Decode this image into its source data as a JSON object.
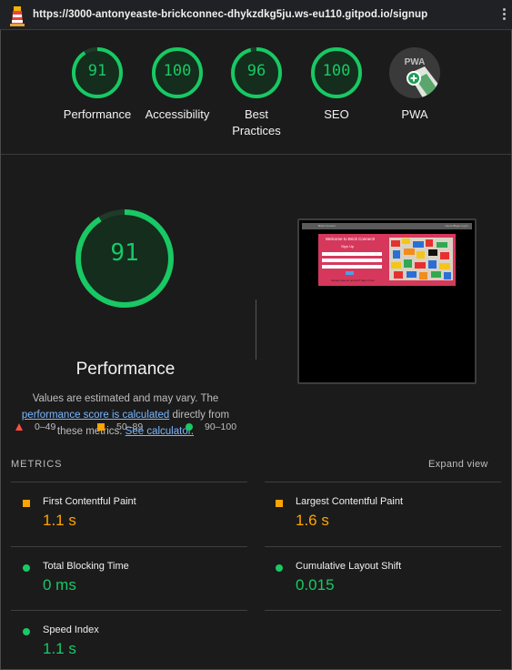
{
  "browser": {
    "url": "https://3000-antonyeaste-brickconnec-dhykzdkg5ju.ws-eu110.gitpod.io/signup"
  },
  "categories": [
    {
      "name": "Performance",
      "score": "91",
      "fraction": 0.91
    },
    {
      "name": "Accessibility",
      "score": "100",
      "fraction": 1.0
    },
    {
      "name": "Best Practices",
      "score": "96",
      "fraction": 0.96
    },
    {
      "name": "SEO",
      "score": "100",
      "fraction": 1.0
    },
    {
      "name": "PWA",
      "score": "PWA",
      "icon": "pwa-badge-icon"
    }
  ],
  "performance": {
    "score": "91",
    "fraction": 0.91,
    "title": "Performance",
    "desc_prefix": "Values are estimated and may vary. The ",
    "desc_link1": "performance score is calculated",
    "desc_middle": " directly from these metrics. ",
    "desc_link2": "See calculator."
  },
  "screenshot": {
    "nav_title": "Brick Connect",
    "nav_links": "Home  Blogs  Log In",
    "card_title": "Welcome to Brick Connect!",
    "card_subtitle": "Sign Up",
    "card_footer": "Already have an account? Sign in here"
  },
  "legend": [
    {
      "range": "0–49",
      "color": "#ff4e42"
    },
    {
      "range": "50–89",
      "color": "#ffa400"
    },
    {
      "range": "90–100",
      "color": "#18c964"
    }
  ],
  "metrics_section": {
    "title": "METRICS",
    "expand_label": "Expand view"
  },
  "metrics": [
    {
      "name": "First Contentful Paint",
      "value": "1.1 s",
      "status": "orange"
    },
    {
      "name": "Largest Contentful Paint",
      "value": "1.6 s",
      "status": "orange"
    },
    {
      "name": "Total Blocking Time",
      "value": "0 ms",
      "status": "green"
    },
    {
      "name": "Cumulative Layout Shift",
      "value": "0.015",
      "status": "green"
    },
    {
      "name": "Speed Index",
      "value": "1.1 s",
      "status": "green"
    }
  ],
  "colors": {
    "pass": "#18c964",
    "average": "#ffa400",
    "fail": "#ff4e42",
    "link": "#7ab7ff"
  }
}
